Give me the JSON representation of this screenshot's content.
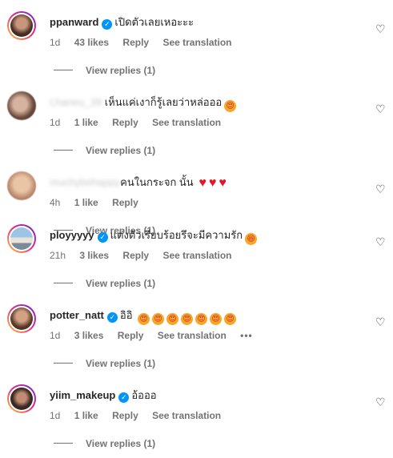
{
  "comments": [
    {
      "username": "ppanward",
      "verified": true,
      "text": "เปิดตัวเลยเหอะะะ",
      "emojis": [],
      "hearts": 0,
      "time": "1d",
      "likes": "43 likes",
      "reply": "Reply",
      "translation": "See translation",
      "more": "",
      "replies": "View replies (1)",
      "blurred": false
    },
    {
      "username": "Lhaneu_39",
      "verified": false,
      "text": "เห็นแค่เงาก็รู้เลยว่าหล่อออ",
      "emojis": [
        "😍"
      ],
      "hearts": 0,
      "time": "1d",
      "likes": "1 like",
      "reply": "Reply",
      "translation": "See translation",
      "more": "",
      "replies": "View replies (1)",
      "blurred": true
    },
    {
      "username": "muchybehappy",
      "verified": false,
      "text": "คนในกระจก นั้น",
      "emojis": [],
      "hearts": 3,
      "time": "4h",
      "likes": "1 like",
      "reply": "Reply",
      "translation": "",
      "more": "",
      "replies": "View replies (1)",
      "blurred": true
    },
    {
      "username": "ployyyyy",
      "verified": true,
      "text": "แต่งตัวเรียบร้อยรึจะมีความรัก",
      "emojis": [
        "😆"
      ],
      "hearts": 0,
      "time": "21h",
      "likes": "3 likes",
      "reply": "Reply",
      "translation": "See translation",
      "more": "",
      "replies": "View replies (1)",
      "blurred": false
    },
    {
      "username": "potter_natt",
      "verified": true,
      "text": "อิอิ",
      "emojis": [
        "😍",
        "😍",
        "😍",
        "😍",
        "😍",
        "😍",
        "😍"
      ],
      "hearts": 0,
      "time": "1d",
      "likes": "3 likes",
      "reply": "Reply",
      "translation": "See translation",
      "more": "•••",
      "replies": "View replies (1)",
      "blurred": false
    },
    {
      "username": "yiim_makeup",
      "verified": true,
      "text": "อ้อออ",
      "emojis": [],
      "hearts": 0,
      "time": "1d",
      "likes": "1 like",
      "reply": "Reply",
      "translation": "See translation",
      "more": "",
      "replies": "View replies (1)",
      "blurred": false
    }
  ],
  "icons": {
    "like": "heart-outline-icon",
    "verified": "verified-badge-icon"
  },
  "colors": {
    "verified": "#0095f6",
    "secondary": "#737373",
    "primary": "#262626"
  }
}
